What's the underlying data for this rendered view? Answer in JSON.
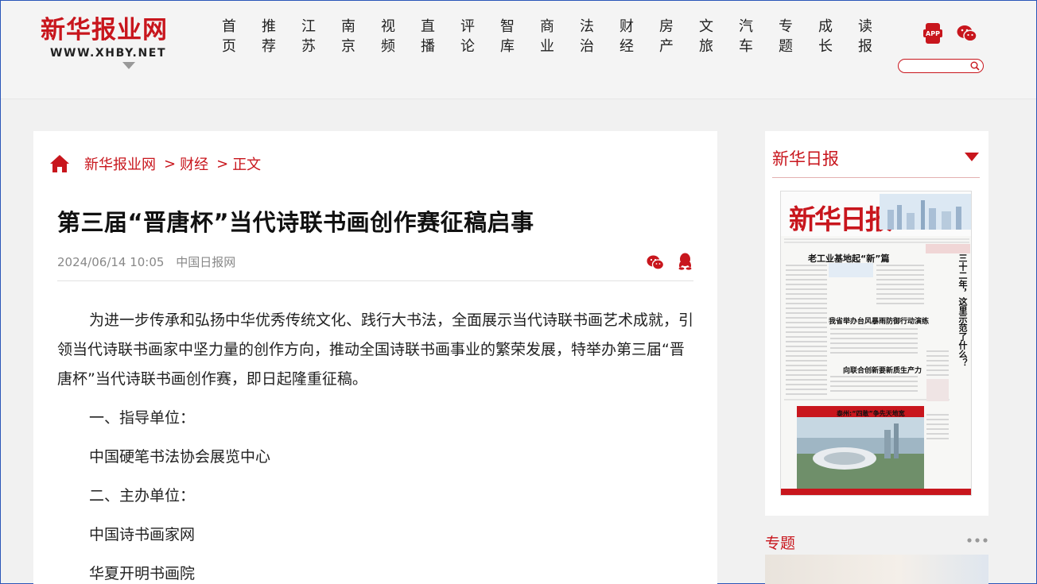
{
  "header": {
    "logo_cn": "新华报业网",
    "logo_en": "WWW.XHBY.NET",
    "nav": [
      {
        "l1": "首",
        "l2": "页"
      },
      {
        "l1": "推",
        "l2": "荐"
      },
      {
        "l1": "江",
        "l2": "苏"
      },
      {
        "l1": "南",
        "l2": "京"
      },
      {
        "l1": "视",
        "l2": "频"
      },
      {
        "l1": "直",
        "l2": "播"
      },
      {
        "l1": "评",
        "l2": "论"
      },
      {
        "l1": "智",
        "l2": "库"
      },
      {
        "l1": "商",
        "l2": "业"
      },
      {
        "l1": "法",
        "l2": "治"
      },
      {
        "l1": "财",
        "l2": "经"
      },
      {
        "l1": "房",
        "l2": "产"
      },
      {
        "l1": "文",
        "l2": "旅"
      },
      {
        "l1": "汽",
        "l2": "车"
      },
      {
        "l1": "专",
        "l2": "题"
      },
      {
        "l1": "成",
        "l2": "长"
      },
      {
        "l1": "读",
        "l2": "报"
      }
    ],
    "app_label": "APP",
    "search_placeholder": ""
  },
  "breadcrumb": {
    "home": "新华报业网",
    "sep": ">",
    "section": "财经",
    "current": "正文"
  },
  "article": {
    "title": "第三届“晋唐杯”当代诗联书画创作赛征稿启事",
    "date": "2024/06/14 10:05",
    "source": "中国日报网",
    "lead": "为进一步传承和弘扬中华优秀传统文化、践行大书法，全面展示当代诗联书画艺术成就，引领当代诗联书画家中坚力量的创作方向，推动全国诗联书画事业的繁荣发展，特举办第三届“晋唐杯”当代诗联书画创作赛，即日起隆重征稿。",
    "items": [
      "一、指导单位：",
      "中国硬笔书法协会展览中心",
      "二、主办单位：",
      "中国诗书画家网",
      "华夏开明书画院"
    ]
  },
  "sidebar": {
    "title": "新华日报",
    "paper": {
      "name": "新华日报",
      "headline1": "老工业基地起“新”篇",
      "headline2": "我省举办台风暴雨防御行动演练",
      "headline3": "向联合创新要新质生产力",
      "caption": "泰州:“四敢”争先天地宽",
      "vertical": "三十二年，这里示范了什么？"
    },
    "topic_title": "专题"
  },
  "colors": {
    "brand_red": "#c8161d",
    "text": "#222222",
    "meta": "#888888"
  }
}
